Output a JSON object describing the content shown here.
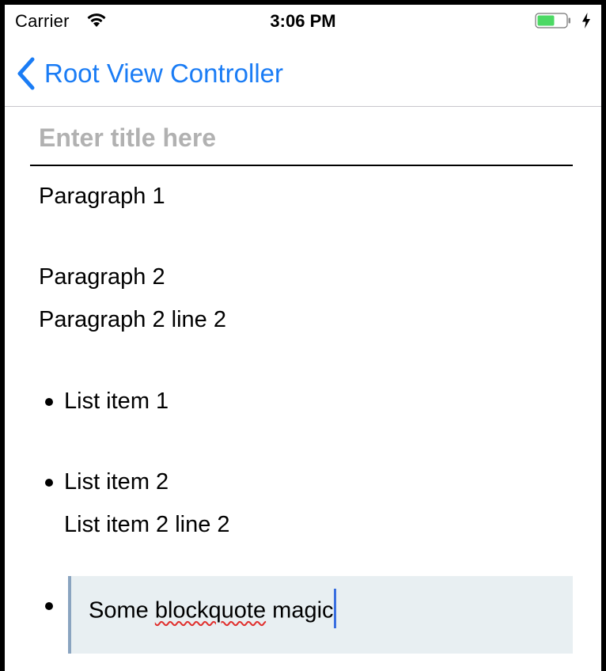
{
  "status_bar": {
    "carrier": "Carrier",
    "time": "3:06 PM",
    "wifi_icon": "wifi-icon",
    "battery_icon": "battery-icon",
    "charging_icon": "charging-bolt-icon",
    "battery_level_fraction": 0.6,
    "battery_color": "#4cd964"
  },
  "nav_bar": {
    "back_label": "Root View Controller",
    "back_icon": "chevron-left-icon",
    "accent_color": "#1a7cf5"
  },
  "editor": {
    "title_placeholder": "Enter title here",
    "title_value": "",
    "paragraphs": [
      "Paragraph 1",
      "Paragraph 2",
      "Paragraph 2 line 2"
    ],
    "list_items": [
      "List item 1",
      "List item 2",
      "List item 2 line 2"
    ],
    "blockquote": {
      "text_before": "Some ",
      "misspelled_word": "blockquote",
      "text_after": " magic",
      "background_color": "#e8eff2",
      "border_color": "#8aa4c0"
    }
  }
}
